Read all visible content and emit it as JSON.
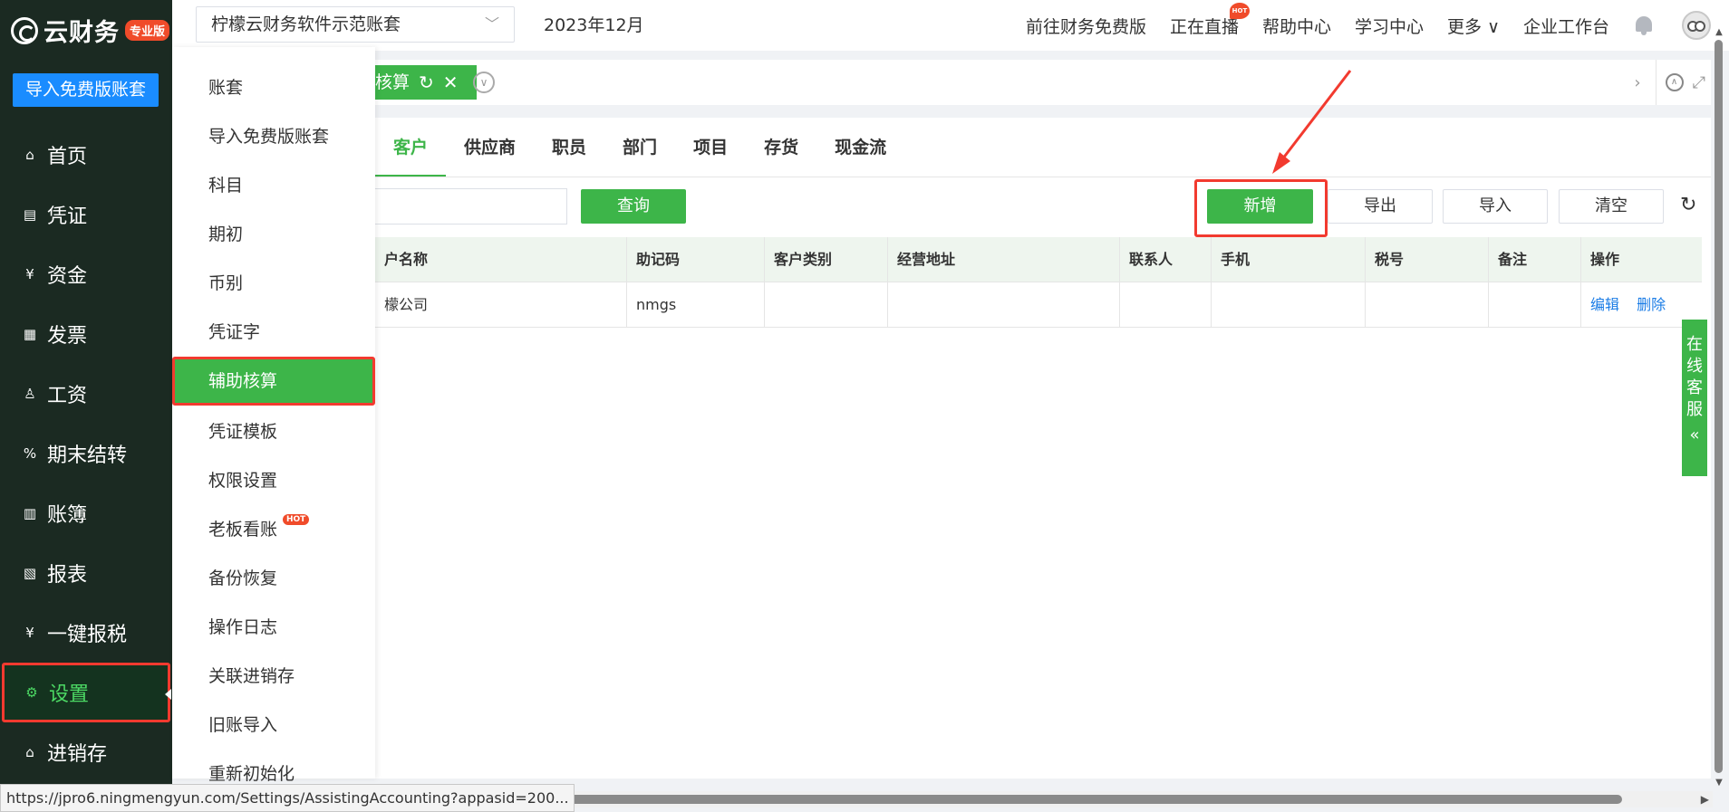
{
  "brand": {
    "name": "云财务",
    "badge": "专业版"
  },
  "sidebar": {
    "import_button": "导入免费版账套",
    "items": [
      {
        "label": "首页",
        "icon": "home-icon",
        "glyph": "⌂"
      },
      {
        "label": "凭证",
        "icon": "voucher-icon",
        "glyph": "▤"
      },
      {
        "label": "资金",
        "icon": "fund-icon",
        "glyph": "¥"
      },
      {
        "label": "发票",
        "icon": "invoice-icon",
        "glyph": "▦"
      },
      {
        "label": "工资",
        "icon": "salary-icon",
        "glyph": "♙"
      },
      {
        "label": "期末结转",
        "icon": "period-close-icon",
        "glyph": "%"
      },
      {
        "label": "账簿",
        "icon": "ledger-icon",
        "glyph": "▥"
      },
      {
        "label": "报表",
        "icon": "report-icon",
        "glyph": "▧"
      },
      {
        "label": "一键报税",
        "icon": "tax-icon",
        "glyph": "¥"
      },
      {
        "label": "设置",
        "icon": "settings-icon",
        "glyph": "⚙"
      },
      {
        "label": "进销存",
        "icon": "inventory-icon",
        "glyph": "⌂"
      }
    ],
    "active_index": 9
  },
  "submenu": {
    "items": [
      "账套",
      "导入免费版账套",
      "科目",
      "期初",
      "币别",
      "凭证字",
      "辅助核算",
      "凭证模板",
      "权限设置",
      "老板看账",
      "备份恢复",
      "操作日志",
      "关联进销存",
      "旧账导入",
      "重新初始化"
    ],
    "active_index": 6,
    "hot_index": 9,
    "hot_label": "HOT"
  },
  "topbar": {
    "account": "柠檬云财务软件示范账套",
    "period": "2023年12月",
    "links": [
      "前往财务免费版",
      "正在直播",
      "帮助中心",
      "学习中心",
      "更多",
      "企业工作台"
    ],
    "live_hot": "HOT"
  },
  "page_tab": {
    "label": "核算"
  },
  "type_tabs": {
    "items": [
      "客户",
      "供应商",
      "职员",
      "部门",
      "项目",
      "存货",
      "现金流"
    ],
    "active_index": 0
  },
  "toolbar": {
    "query": "查询",
    "add": "新增",
    "export": "导出",
    "import": "导入",
    "clear": "清空"
  },
  "table": {
    "headers": [
      "户名称",
      "助记码",
      "客户类别",
      "经营地址",
      "联系人",
      "手机",
      "税号",
      "备注",
      "操作"
    ],
    "rows": [
      {
        "name": "檬公司",
        "code": "nmgs",
        "category": "",
        "address": "",
        "contact": "",
        "phone": "",
        "tax": "",
        "note": "",
        "edit": "编辑",
        "delete": "删除"
      }
    ]
  },
  "online_service": {
    "label": "在线客服"
  },
  "status_url": "https://jpro6.ningmengyun.com/Settings/AssistingAccounting?appasid=200...",
  "colors": {
    "sidebar": "#1b2a22",
    "accent": "#3db549",
    "highlight": "#f23a2f",
    "primary": "#1a8cff",
    "link": "#1a7ce6"
  }
}
